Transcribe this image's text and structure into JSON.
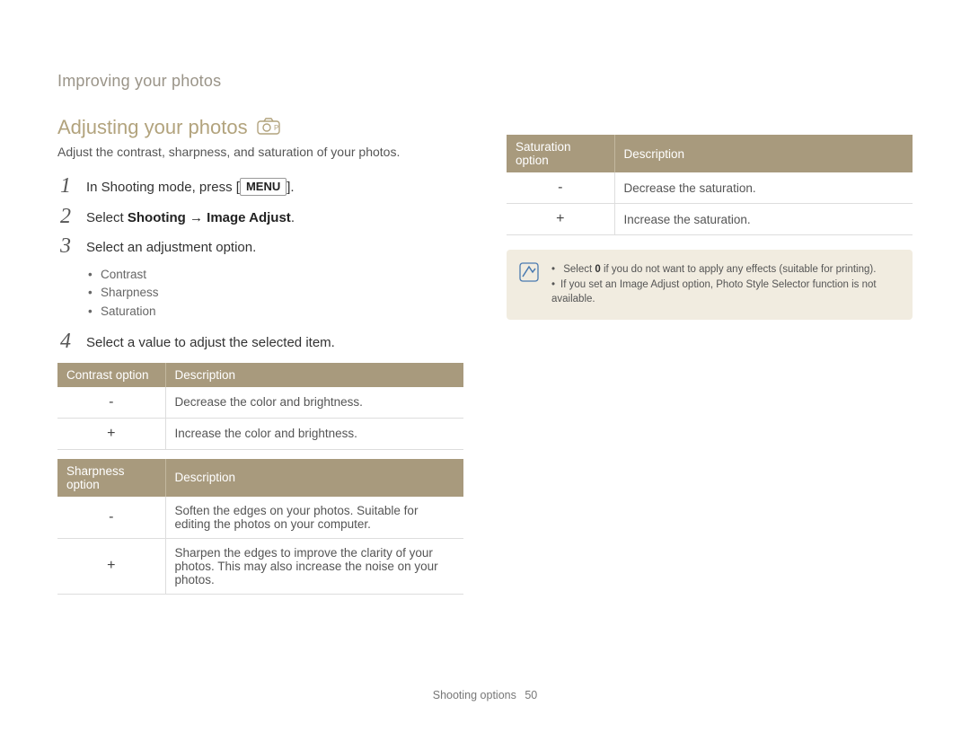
{
  "header": {
    "section": "Improving your photos"
  },
  "title": "Adjusting your photos",
  "icon_name": "camera-p-icon",
  "intro": "Adjust the contrast, sharpness, and saturation of your photos.",
  "steps": [
    {
      "num": "1",
      "pre": "In Shooting mode, press [",
      "btn": "MENU",
      "post": "]."
    },
    {
      "num": "2",
      "pre": "Select ",
      "bold": "Shooting → Image Adjust",
      "post": "."
    },
    {
      "num": "3",
      "pre": "Select an adjustment option."
    },
    {
      "num": "4",
      "pre": "Select a value to adjust the selected item."
    }
  ],
  "sub_bullets": [
    "Contrast",
    "Sharpness",
    "Saturation"
  ],
  "tables": {
    "contrast": {
      "head": [
        "Contrast option",
        "Description"
      ],
      "rows": [
        {
          "opt": "-",
          "desc": "Decrease the color and brightness."
        },
        {
          "opt": "+",
          "desc": "Increase the color and brightness."
        }
      ]
    },
    "sharpness": {
      "head": [
        "Sharpness option",
        "Description"
      ],
      "rows": [
        {
          "opt": "-",
          "desc": "Soften the edges on your photos. Suitable for editing the photos on your computer."
        },
        {
          "opt": "+",
          "desc": "Sharpen the edges to improve the clarity of your photos. This may also increase the noise on your photos."
        }
      ]
    },
    "saturation": {
      "head": [
        "Saturation option",
        "Description"
      ],
      "rows": [
        {
          "opt": "-",
          "desc": "Decrease the saturation."
        },
        {
          "opt": "+",
          "desc": "Increase the saturation."
        }
      ]
    }
  },
  "notes": [
    {
      "pre": "Select ",
      "bold": "0",
      "post": " if you do not want to apply any effects (suitable for printing)."
    },
    {
      "pre": "If you set an Image Adjust option, Photo Style Selector function is not available."
    }
  ],
  "footer": {
    "label": "Shooting options",
    "page": "50"
  }
}
